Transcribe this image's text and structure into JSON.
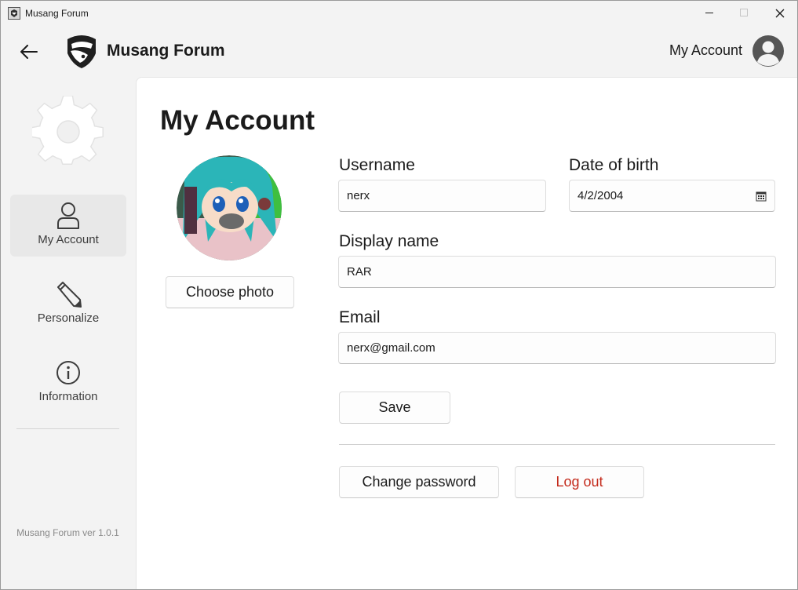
{
  "window": {
    "title": "Musang Forum"
  },
  "header": {
    "brand": "Musang Forum",
    "account_label": "My Account"
  },
  "sidebar": {
    "items": [
      {
        "label": "My Account",
        "icon": "person-icon",
        "active": true
      },
      {
        "label": "Personalize",
        "icon": "pencil-icon",
        "active": false
      },
      {
        "label": "Information",
        "icon": "info-icon",
        "active": false
      }
    ],
    "version": "Musang Forum ver 1.0.1"
  },
  "main": {
    "title": "My Account",
    "choose_photo_label": "Choose photo",
    "fields": {
      "username": {
        "label": "Username",
        "value": "nerx"
      },
      "dob": {
        "label": "Date of birth",
        "value": "4/2/2004"
      },
      "display_name": {
        "label": "Display name",
        "value": "RAR"
      },
      "email": {
        "label": "Email",
        "value": "nerx@gmail.com"
      }
    },
    "save_label": "Save",
    "change_password_label": "Change password",
    "logout_label": "Log out"
  },
  "colors": {
    "logout_text": "#c42b1c",
    "sidebar_bg": "#f3f3f3",
    "panel_bg": "#ffffff"
  }
}
